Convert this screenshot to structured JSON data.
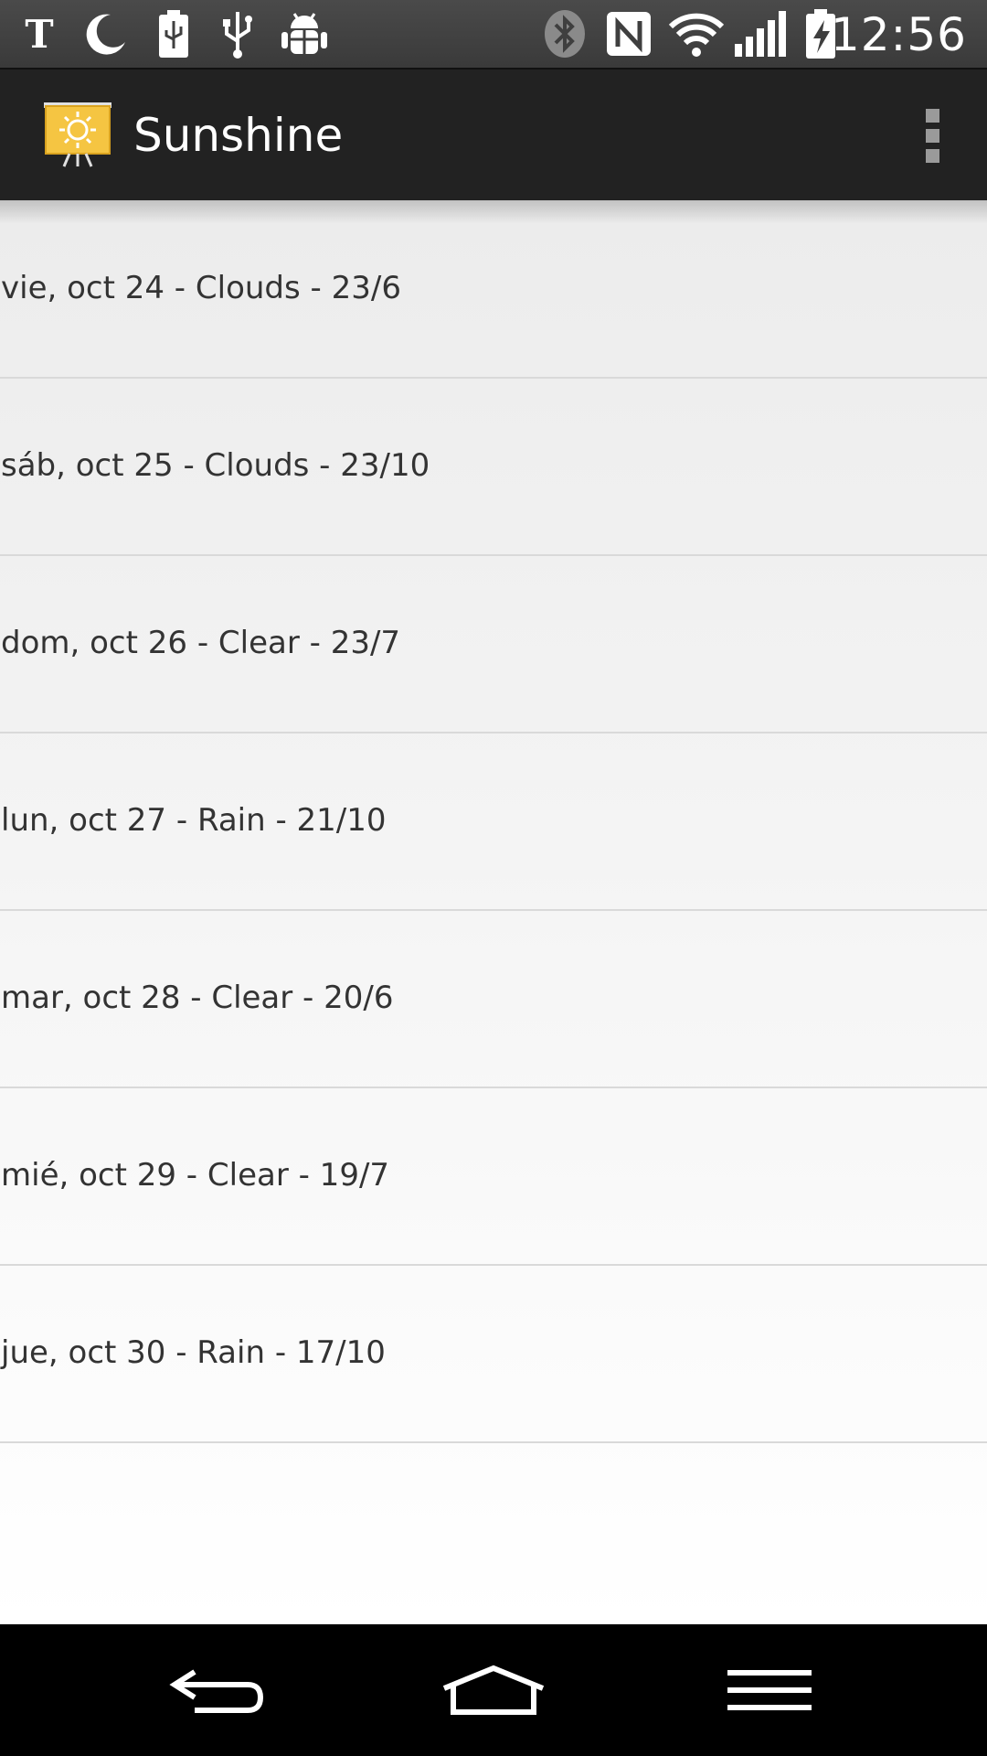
{
  "status_bar": {
    "time": "12:56",
    "left_icons": [
      "nyt-icon",
      "moon-icon",
      "battery-usb-icon",
      "usb-icon",
      "android-debug-icon"
    ],
    "right_icons": [
      "bluetooth-icon",
      "nfc-icon",
      "wifi-icon",
      "signal-icon",
      "battery-charging-icon"
    ]
  },
  "action_bar": {
    "title": "Sunshine",
    "app_icon": "sunshine-app-icon",
    "overflow_icon": "overflow-menu-icon"
  },
  "forecast": {
    "items": [
      {
        "label": "vie, oct 24 - Clouds - 23/6"
      },
      {
        "label": "sáb, oct 25 - Clouds - 23/10"
      },
      {
        "label": "dom, oct 26 - Clear - 23/7"
      },
      {
        "label": "lun, oct 27 - Rain - 21/10"
      },
      {
        "label": "mar, oct 28 - Clear - 20/6"
      },
      {
        "label": "mié, oct 29 - Clear - 19/7"
      },
      {
        "label": "jue, oct 30 - Rain - 17/10"
      }
    ]
  },
  "nav_bar": {
    "back_icon": "back-icon",
    "home_icon": "home-icon",
    "menu_icon": "menu-icon"
  },
  "colors": {
    "status_bar": "#3f3f3f",
    "action_bar": "#222222",
    "list_text": "#333333",
    "divider": "#d9d9d9",
    "nav_bar": "#000000",
    "app_icon_yellow": "#f5c542"
  }
}
